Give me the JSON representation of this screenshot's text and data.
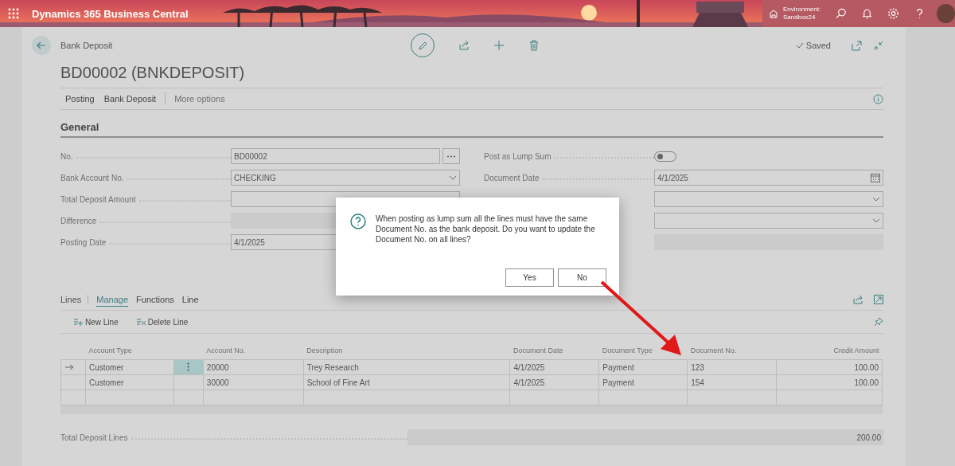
{
  "app": {
    "title": "Dynamics 365 Business Central",
    "environment_label": "Environment:",
    "environment": "Sandbox24"
  },
  "page": {
    "breadcrumb": "Bank Deposit",
    "title": "BD00002 (BNKDEPOSIT)",
    "status": "Saved",
    "actions": [
      "Posting",
      "Bank Deposit"
    ],
    "more": "More options"
  },
  "general": {
    "heading": "General",
    "left": [
      {
        "kind": "lookup",
        "label": "No.",
        "value": "BD00002"
      },
      {
        "kind": "dropdown",
        "label": "Bank Account No.",
        "value": "CHECKING"
      },
      {
        "kind": "text",
        "label": "Total Deposit Amount"
      },
      {
        "kind": "readonly",
        "label": "Difference"
      },
      {
        "kind": "text",
        "label": "Posting Date",
        "value": "4/1/2025"
      }
    ],
    "right": [
      {
        "kind": "toggle",
        "label": "Post as Lump Sum",
        "on": false
      },
      {
        "kind": "date",
        "label": "Document Date",
        "value": "4/1/2025"
      },
      {
        "kind": "dropdown"
      },
      {
        "kind": "dropdown"
      },
      {
        "kind": "readonly"
      }
    ]
  },
  "lines": {
    "heading": "Lines",
    "tabs": [
      {
        "label": "Manage",
        "selected": true
      },
      {
        "label": "Functions",
        "selected": false
      },
      {
        "label": "Line",
        "selected": false
      }
    ],
    "toolbar": [
      {
        "kind": "new",
        "label": "New Line"
      },
      {
        "kind": "delete",
        "label": "Delete Line"
      }
    ],
    "columns": [
      "Account Type",
      "Account No.",
      "Description",
      "Document Date",
      "Document Type",
      "Document No.",
      "Credit Amount"
    ],
    "rows": [
      {
        "current": true,
        "cells": [
          "Customer",
          "20000",
          "Trey Research",
          "4/1/2025",
          "Payment",
          "123",
          "100.00"
        ]
      },
      {
        "current": false,
        "cells": [
          "Customer",
          "30000",
          "School of Fine Art",
          "4/1/2025",
          "Payment",
          "154",
          "100.00"
        ]
      }
    ]
  },
  "total": {
    "label": "Total Deposit Lines",
    "value": "200.00"
  },
  "dialog": {
    "message": "When posting as lump sum all the lines must have the same Document No. as the bank deposit. Do you want to update the Document No. on all lines?",
    "buttons": [
      "Yes",
      "No"
    ]
  }
}
